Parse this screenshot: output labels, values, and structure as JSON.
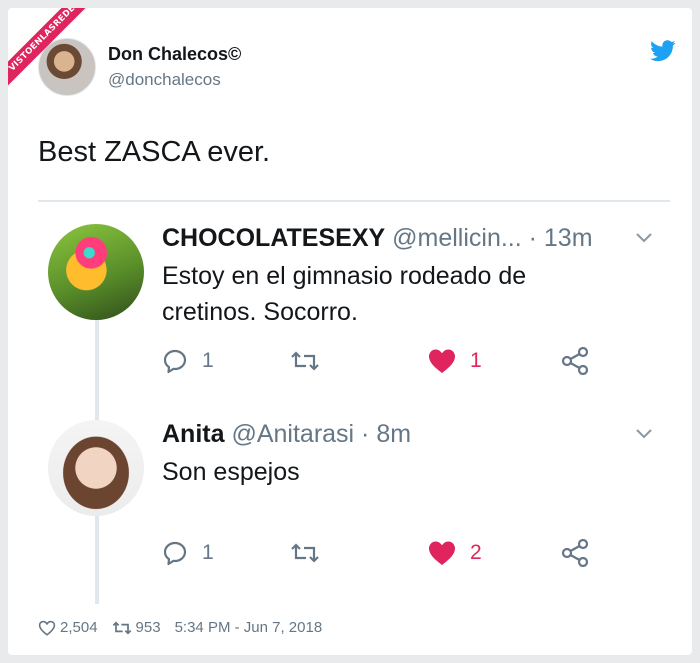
{
  "watermark": {
    "text": "VISTOENLASREDES"
  },
  "author": {
    "name": "Don Chalecos©",
    "handle": "@donchalecos"
  },
  "tweet": {
    "text": "Best ZASCA ever."
  },
  "replies": [
    {
      "name": "CHOCOLATESEXY",
      "meta": "@mellicin... · 13m",
      "text": "Estoy en el gimnasio rodeado de cretinos. Socorro.",
      "reply_count": "1",
      "retweet_count": "",
      "like_count": "1"
    },
    {
      "name": "Anita",
      "meta": "@Anitarasi · 8m",
      "text": "Son espejos",
      "reply_count": "1",
      "retweet_count": "",
      "like_count": "2"
    }
  ],
  "footer": {
    "likes": "2,504",
    "retweets": "953",
    "timestamp": "5:34 PM - Jun 7, 2018"
  },
  "colors": {
    "like": "#e0245e",
    "twitter_blue": "#1da1f2",
    "muted": "#657786"
  },
  "icons": [
    "twitter-bird-icon",
    "chevron-down-icon",
    "reply-icon",
    "retweet-icon",
    "heart-icon",
    "share-icon"
  ]
}
